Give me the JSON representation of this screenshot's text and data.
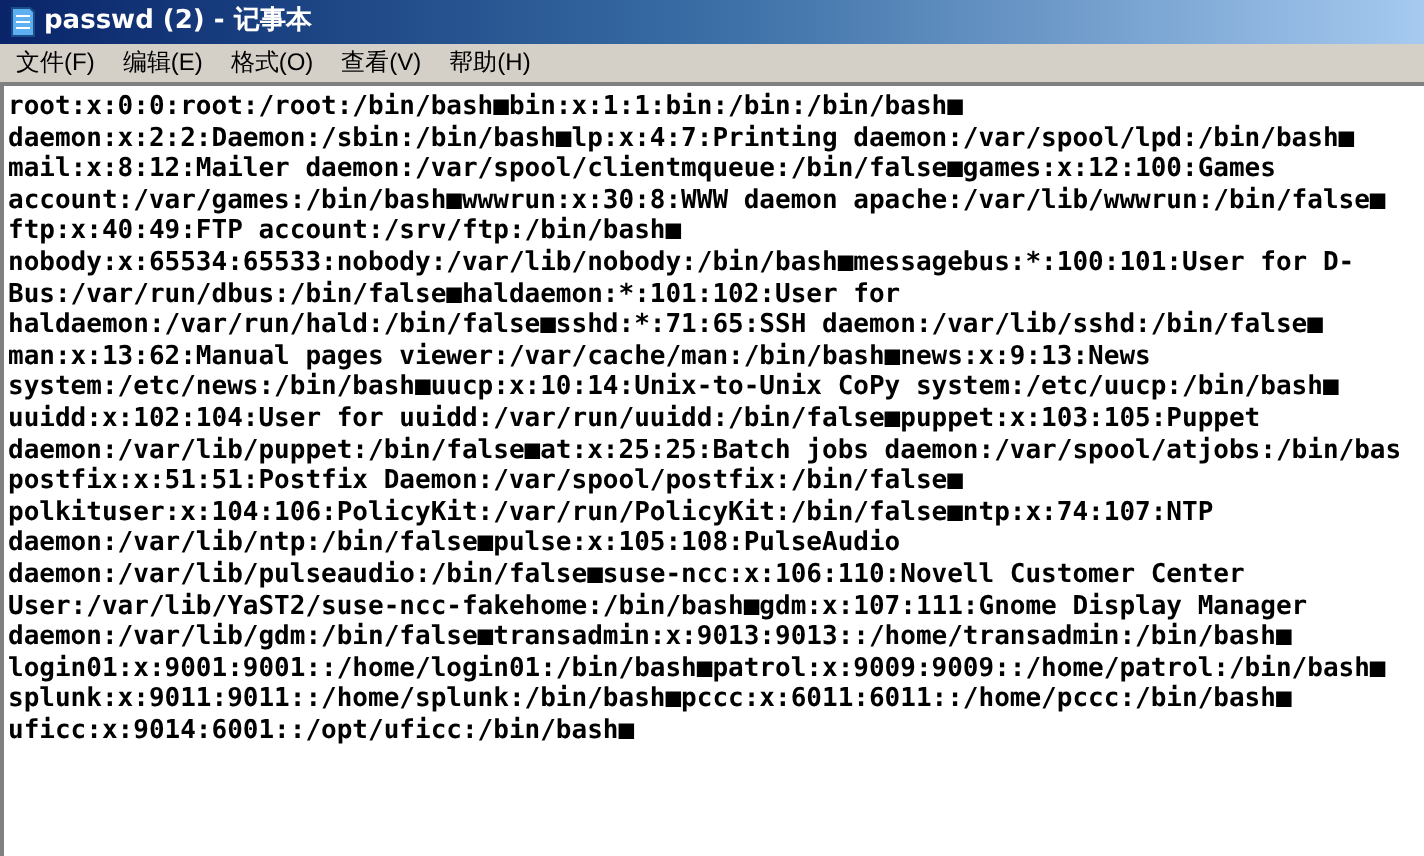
{
  "window": {
    "title": "passwd (2) - 记事本"
  },
  "menu": [
    "文件(F)",
    "编辑(E)",
    "格式(O)",
    "查看(V)",
    "帮助(H)"
  ],
  "editor": {
    "lines": [
      "root:x:0:0:root:/root:/bin/bash■bin:x:1:1:bin:/bin:/bin/bash■",
      "daemon:x:2:2:Daemon:/sbin:/bin/bash■lp:x:4:7:Printing daemon:/var/spool/lpd:/bin/bash■",
      "mail:x:8:12:Mailer daemon:/var/spool/clientmqueue:/bin/false■games:x:12:100:Games",
      "account:/var/games:/bin/bash■wwwrun:x:30:8:WWW daemon apache:/var/lib/wwwrun:/bin/false■",
      "ftp:x:40:49:FTP account:/srv/ftp:/bin/bash■",
      "nobody:x:65534:65533:nobody:/var/lib/nobody:/bin/bash■messagebus:*:100:101:User for D-",
      "Bus:/var/run/dbus:/bin/false■haldaemon:*:101:102:User for",
      "haldaemon:/var/run/hald:/bin/false■sshd:*:71:65:SSH daemon:/var/lib/sshd:/bin/false■",
      "man:x:13:62:Manual pages viewer:/var/cache/man:/bin/bash■news:x:9:13:News",
      "system:/etc/news:/bin/bash■uucp:x:10:14:Unix-to-Unix CoPy system:/etc/uucp:/bin/bash■",
      "uuidd:x:102:104:User for uuidd:/var/run/uuidd:/bin/false■puppet:x:103:105:Puppet",
      "daemon:/var/lib/puppet:/bin/false■at:x:25:25:Batch jobs daemon:/var/spool/atjobs:/bin/bas",
      "postfix:x:51:51:Postfix Daemon:/var/spool/postfix:/bin/false■",
      "polkituser:x:104:106:PolicyKit:/var/run/PolicyKit:/bin/false■ntp:x:74:107:NTP",
      "daemon:/var/lib/ntp:/bin/false■pulse:x:105:108:PulseAudio",
      "daemon:/var/lib/pulseaudio:/bin/false■suse-ncc:x:106:110:Novell Customer Center",
      "User:/var/lib/YaST2/suse-ncc-fakehome:/bin/bash■gdm:x:107:111:Gnome Display Manager",
      "daemon:/var/lib/gdm:/bin/false■transadmin:x:9013:9013::/home/transadmin:/bin/bash■",
      "login01:x:9001:9001::/home/login01:/bin/bash■patrol:x:9009:9009::/home/patrol:/bin/bash■",
      "splunk:x:9011:9011::/home/splunk:/bin/bash■pccc:x:6011:6011::/home/pccc:/bin/bash■",
      "uficc:x:9014:6001::/opt/uficc:/bin/bash■"
    ]
  }
}
